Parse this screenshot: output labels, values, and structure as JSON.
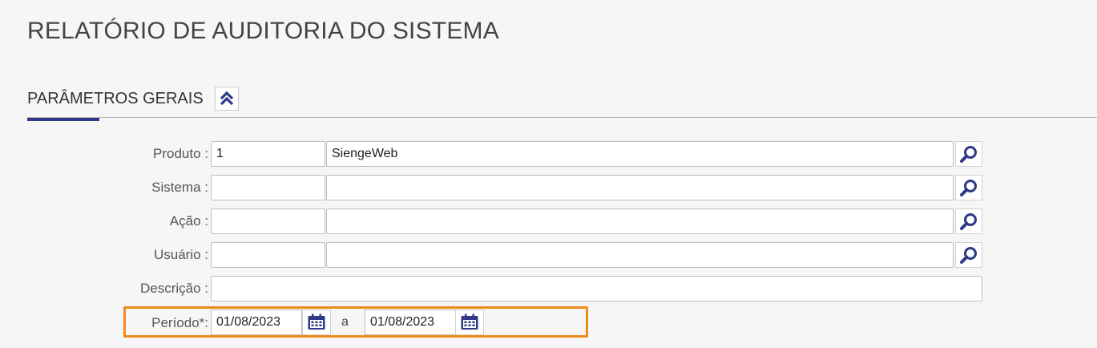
{
  "page": {
    "title": "RELATÓRIO DE AUDITORIA DO SISTEMA"
  },
  "section": {
    "title": "PARÂMETROS GERAIS",
    "collapse_icon": "double-chevron-up-icon"
  },
  "colors": {
    "accent": "#2e3a87",
    "highlight": "#f08a1c"
  },
  "form": {
    "produto": {
      "label": "Produto :",
      "code": "1",
      "name": "SiengeWeb"
    },
    "sistema": {
      "label": "Sistema :",
      "code": "",
      "name": ""
    },
    "acao": {
      "label": "Ação :",
      "code": "",
      "name": ""
    },
    "usuario": {
      "label": "Usuário :",
      "code": "",
      "name": ""
    },
    "descricao": {
      "label": "Descrição :",
      "value": ""
    },
    "periodo": {
      "label": "Período*:",
      "start": "01/08/2023",
      "separator": "a",
      "end": "01/08/2023"
    }
  }
}
